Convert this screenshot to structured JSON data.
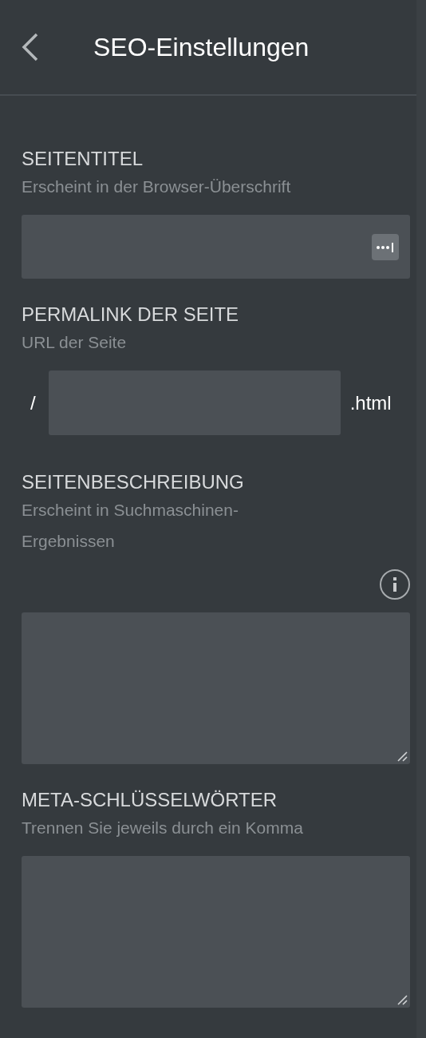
{
  "header": {
    "title": "SEO-Einstellungen"
  },
  "fields": [
    {
      "kind": "text",
      "label": "SEITENTITEL",
      "hint": "Erscheint in der Browser-Überschrift",
      "password_manager": true
    },
    {
      "kind": "permalink",
      "label": "PERMALINK DER SEITE",
      "hint": "URL der Seite",
      "prefix": "/",
      "suffix": ".html"
    },
    {
      "kind": "textarea",
      "label": "SEITENBESCHREIBUNG",
      "hint": "Erscheint in Suchmaschinen-Ergebnissen",
      "info": true
    },
    {
      "kind": "textarea",
      "label": "META-SCHLÜSSELWÖRTER",
      "hint": "Trennen Sie jeweils durch ein Komma"
    }
  ]
}
